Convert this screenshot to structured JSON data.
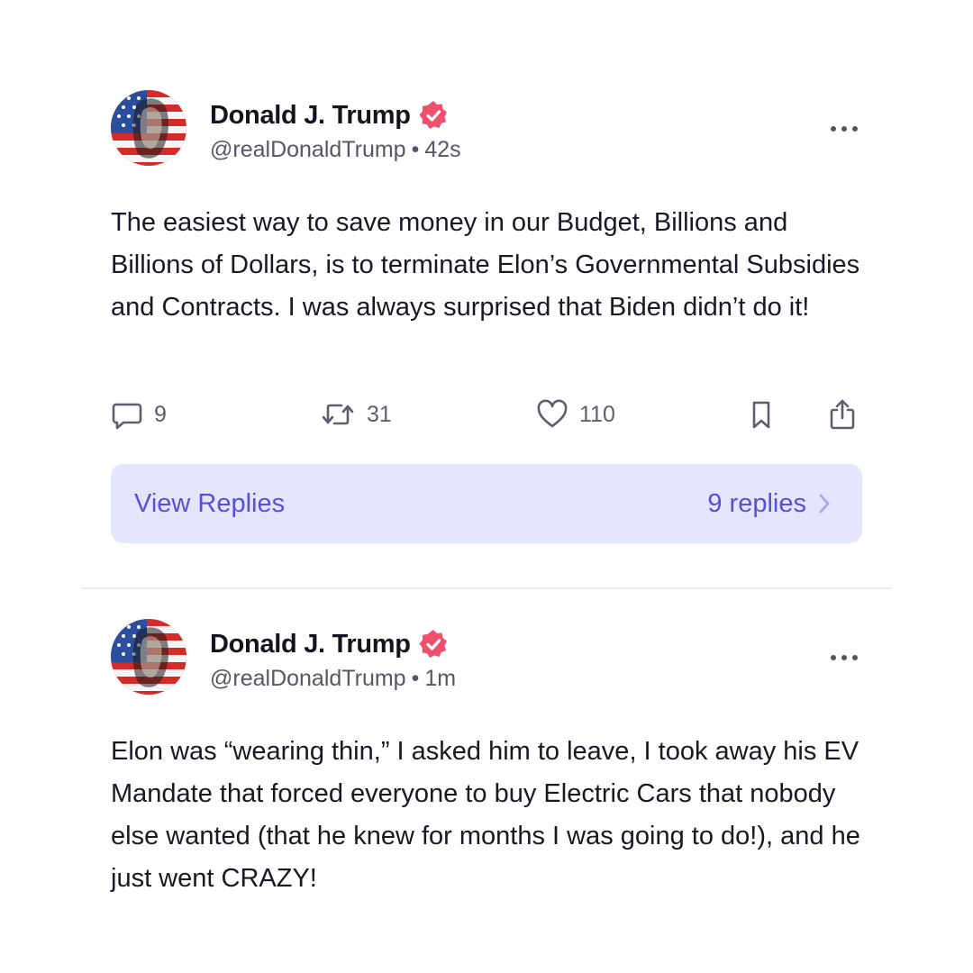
{
  "posts": [
    {
      "author": "Donald J. Trump",
      "handle": "@realDonaldTrump",
      "separator": "•",
      "time": "42s",
      "text": "The easiest way to save money in our Budget, Billions and Billions of Dollars, is to terminate Elon’s Governmental Subsidies and Contracts. I was always surprised that Biden didn’t do it!",
      "stats": {
        "replies": "9",
        "reposts": "31",
        "likes": "110"
      },
      "view_replies_label": "View Replies",
      "replies_count_label": "9 replies"
    },
    {
      "author": "Donald J. Trump",
      "handle": "@realDonaldTrump",
      "separator": "•",
      "time": "1m",
      "text": "Elon was “wearing thin,” I asked him to leave, I took away his EV Mandate that forced everyone to buy Electric Cars that nobody else wanted (that he knew for months I was going to do!), and he just went CRAZY!"
    }
  ],
  "icons": {
    "verified": "verified-badge-icon",
    "more": "more-options-icon",
    "reply": "reply-bubble-icon",
    "repost": "repost-icon",
    "like": "heart-icon",
    "bookmark": "bookmark-icon",
    "share": "share-icon",
    "chevron": "chevron-right-icon"
  },
  "colors": {
    "verified_badge": "#f0506e",
    "action_gray": "#5e5e70",
    "view_replies_bg": "#e4e6ff",
    "view_replies_text": "#5a4fd8",
    "divider": "#e9e9ee"
  }
}
